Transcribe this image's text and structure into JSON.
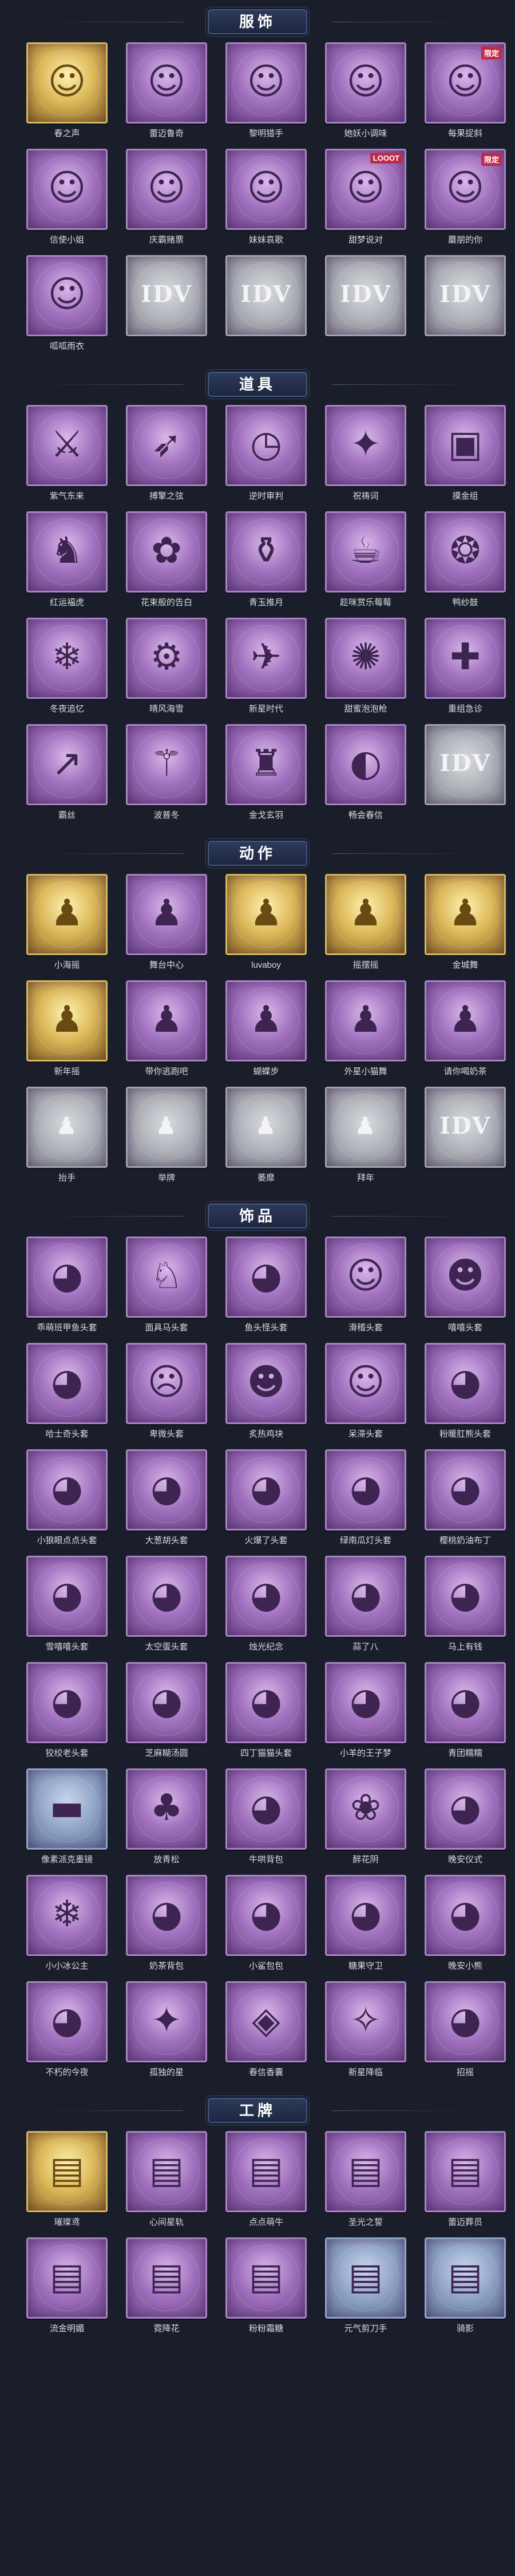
{
  "sections": [
    {
      "title": "服饰",
      "items": [
        {
          "label": "春之声",
          "style": "gold",
          "icon": "character-portrait-icon",
          "glyph": "☺"
        },
        {
          "label": "蕾迈鲁奇",
          "style": "purple",
          "icon": "character-portrait-icon",
          "glyph": "☺"
        },
        {
          "label": "黎明猎手",
          "style": "purple",
          "icon": "character-portrait-icon",
          "glyph": "☺"
        },
        {
          "label": "她妖小调味",
          "style": "purple",
          "icon": "character-portrait-icon",
          "glyph": "☺"
        },
        {
          "label": "每果捉斜",
          "style": "purple",
          "icon": "character-portrait-icon",
          "glyph": "☺",
          "badge": "限定"
        },
        {
          "label": "信使小姐",
          "style": "purple",
          "icon": "character-portrait-icon",
          "glyph": "☺"
        },
        {
          "label": "庆霸赌票",
          "style": "purple",
          "icon": "character-portrait-icon",
          "glyph": "☺"
        },
        {
          "label": "妹妹哀歌",
          "style": "purple",
          "icon": "character-portrait-icon",
          "glyph": "☺"
        },
        {
          "label": "甜梦说对",
          "style": "purple",
          "icon": "character-portrait-icon",
          "glyph": "☺",
          "badge": "LOOOT"
        },
        {
          "label": "蘑朋的你",
          "style": "purple",
          "icon": "character-portrait-icon",
          "glyph": "☺",
          "badge": "限定"
        },
        {
          "label": "呱呱雨衣",
          "style": "purple",
          "icon": "character-portrait-icon",
          "glyph": "☺"
        },
        {
          "label": "",
          "style": "locked",
          "icon": "locked-placeholder-icon",
          "glyph": "IDV"
        },
        {
          "label": "",
          "style": "locked",
          "icon": "locked-placeholder-icon",
          "glyph": "IDV"
        },
        {
          "label": "",
          "style": "locked",
          "icon": "locked-placeholder-icon",
          "glyph": "IDV"
        },
        {
          "label": "",
          "style": "locked",
          "icon": "locked-placeholder-icon",
          "glyph": "IDV"
        }
      ]
    },
    {
      "title": "道具",
      "items": [
        {
          "label": "紫气东来",
          "style": "purple",
          "icon": "weapon-icon",
          "glyph": "⚔"
        },
        {
          "label": "搏擎之弦",
          "style": "purple",
          "icon": "bow-icon",
          "glyph": "➶"
        },
        {
          "label": "逆时审判",
          "style": "purple",
          "icon": "clock-icon",
          "glyph": "◷"
        },
        {
          "label": "祝祷词",
          "style": "purple",
          "icon": "staff-icon",
          "glyph": "✦"
        },
        {
          "label": "摸金组",
          "style": "purple",
          "icon": "tile-icon",
          "glyph": "▣"
        },
        {
          "label": "红运福虎",
          "style": "purple",
          "icon": "tiger-icon",
          "glyph": "♞"
        },
        {
          "label": "花束般的告白",
          "style": "purple",
          "icon": "flower-icon",
          "glyph": "✿"
        },
        {
          "label": "青玉推月",
          "style": "purple",
          "icon": "bottle-icon",
          "glyph": "⚱"
        },
        {
          "label": "趁咪赏乐莓莓",
          "style": "purple",
          "icon": "milk-bottle-icon",
          "glyph": "☕"
        },
        {
          "label": "鸭纱鼓",
          "style": "purple",
          "icon": "drum-icon",
          "glyph": "❂"
        },
        {
          "label": "冬夜追忆",
          "style": "purple",
          "icon": "snow-globe-icon",
          "glyph": "❄"
        },
        {
          "label": "晴风海雪",
          "style": "purple",
          "icon": "robot-icon",
          "glyph": "⚙"
        },
        {
          "label": "新星时代",
          "style": "purple",
          "icon": "gun-icon",
          "glyph": "✈"
        },
        {
          "label": "甜蜜泡泡枪",
          "style": "purple",
          "icon": "bubble-gun-icon",
          "glyph": "✺"
        },
        {
          "label": "重组急诊",
          "style": "purple",
          "icon": "medkit-icon",
          "glyph": "✚"
        },
        {
          "label": "霸丝",
          "style": "purple",
          "icon": "spear-icon",
          "glyph": "↗"
        },
        {
          "label": "波普冬",
          "style": "purple",
          "icon": "wand-icon",
          "glyph": "⚚"
        },
        {
          "label": "金戈玄羽",
          "style": "purple",
          "icon": "lantern-icon",
          "glyph": "♜"
        },
        {
          "label": "畅会春信",
          "style": "purple",
          "icon": "fan-icon",
          "glyph": "◐"
        },
        {
          "label": "",
          "style": "locked",
          "icon": "locked-placeholder-icon",
          "glyph": "IDV"
        }
      ]
    },
    {
      "title": "动作",
      "items": [
        {
          "label": "小海摇",
          "style": "gold",
          "icon": "pose-icon",
          "glyph": "♟"
        },
        {
          "label": "舞台中心",
          "style": "purple",
          "icon": "pose-icon",
          "glyph": "♟"
        },
        {
          "label": "luvaboy",
          "style": "gold",
          "icon": "pose-icon",
          "glyph": "♟"
        },
        {
          "label": "摇摆摇",
          "style": "gold",
          "icon": "pose-icon",
          "glyph": "♟"
        },
        {
          "label": "金城舞",
          "style": "gold",
          "icon": "pose-icon",
          "glyph": "♟"
        },
        {
          "label": "新年摇",
          "style": "gold",
          "icon": "pose-icon",
          "glyph": "♟"
        },
        {
          "label": "带你逃跑吧",
          "style": "purple",
          "icon": "pose-icon",
          "glyph": "♟"
        },
        {
          "label": "蝴蝶步",
          "style": "purple",
          "icon": "pose-icon",
          "glyph": "♟"
        },
        {
          "label": "外星小猫舞",
          "style": "purple",
          "icon": "pose-icon",
          "glyph": "♟"
        },
        {
          "label": "请你喝奶茶",
          "style": "purple",
          "icon": "pose-icon",
          "glyph": "♟"
        },
        {
          "label": "抬手",
          "style": "locked",
          "icon": "pose-icon",
          "glyph": "♟"
        },
        {
          "label": "举牌",
          "style": "locked",
          "icon": "pose-icon",
          "glyph": "♟"
        },
        {
          "label": "萎靡",
          "style": "locked",
          "icon": "pose-icon",
          "glyph": "♟"
        },
        {
          "label": "拜年",
          "style": "locked",
          "icon": "pose-icon",
          "glyph": "♟"
        },
        {
          "label": "",
          "style": "locked",
          "icon": "locked-placeholder-icon",
          "glyph": "IDV"
        }
      ]
    },
    {
      "title": "饰品",
      "items": [
        {
          "label": "乖萌班甲鱼头套",
          "style": "purple",
          "icon": "head-accessory-icon",
          "glyph": "◕"
        },
        {
          "label": "面具马头套",
          "style": "purple",
          "icon": "horse-head-icon",
          "glyph": "♘"
        },
        {
          "label": "鱼头怪头套",
          "style": "purple",
          "icon": "fish-head-icon",
          "glyph": "◕"
        },
        {
          "label": "滑稽头套",
          "style": "purple",
          "icon": "smiley-head-icon",
          "glyph": "☺"
        },
        {
          "label": "嘻嘻头套",
          "style": "purple",
          "icon": "grin-head-icon",
          "glyph": "☻"
        },
        {
          "label": "哈士奇头套",
          "style": "purple",
          "icon": "dog-head-icon",
          "glyph": "◕"
        },
        {
          "label": "卑微头套",
          "style": "purple",
          "icon": "sad-head-icon",
          "glyph": "☹"
        },
        {
          "label": "炙热鸡块",
          "style": "purple",
          "icon": "nugget-head-icon",
          "glyph": "☻"
        },
        {
          "label": "呆滞头套",
          "style": "purple",
          "icon": "dazed-head-icon",
          "glyph": "☺"
        },
        {
          "label": "粉暖肛熊头套",
          "style": "purple",
          "icon": "bear-head-icon",
          "glyph": "◕"
        },
        {
          "label": "小狼眼点点头套",
          "style": "purple",
          "icon": "head-accessory-icon",
          "glyph": "◕"
        },
        {
          "label": "大葱胡头套",
          "style": "purple",
          "icon": "leek-head-icon",
          "glyph": "◕"
        },
        {
          "label": "火爆了头套",
          "style": "purple",
          "icon": "fire-head-icon",
          "glyph": "◕"
        },
        {
          "label": "绿南瓜灯头套",
          "style": "purple",
          "icon": "pumpkin-head-icon",
          "glyph": "◕"
        },
        {
          "label": "樱桃奶油布丁",
          "style": "purple",
          "icon": "pudding-head-icon",
          "glyph": "◕"
        },
        {
          "label": "雪嘻嘻头套",
          "style": "purple",
          "icon": "pig-head-icon",
          "glyph": "◕"
        },
        {
          "label": "太空蛋头套",
          "style": "purple",
          "icon": "egg-head-icon",
          "glyph": "◕"
        },
        {
          "label": "烛光纪念",
          "style": "purple",
          "icon": "candle-head-icon",
          "glyph": "◕"
        },
        {
          "label": "蒜了八",
          "style": "purple",
          "icon": "garlic-head-icon",
          "glyph": "◕"
        },
        {
          "label": "马上有钱",
          "style": "purple",
          "icon": "horse-toy-icon",
          "glyph": "◕"
        },
        {
          "label": "狡绞老头套",
          "style": "purple",
          "icon": "cloud-head-icon",
          "glyph": "◕"
        },
        {
          "label": "芝麻糊汤圆",
          "style": "purple",
          "icon": "dumpling-head-icon",
          "glyph": "◕"
        },
        {
          "label": "四丁猫猫头套",
          "style": "purple",
          "icon": "cat-head-icon",
          "glyph": "◕"
        },
        {
          "label": "小羊的王子梦",
          "style": "purple",
          "icon": "sheep-head-icon",
          "glyph": "◕"
        },
        {
          "label": "青团糯糯",
          "style": "purple",
          "icon": "qingtuan-head-icon",
          "glyph": "◕"
        },
        {
          "label": "像素派克墨镜",
          "style": "blue",
          "icon": "sunglasses-icon",
          "glyph": "▬"
        },
        {
          "label": "放青松",
          "style": "purple",
          "icon": "bonsai-icon",
          "glyph": "♣"
        },
        {
          "label": "牛哄背包",
          "style": "purple",
          "icon": "backpack-icon",
          "glyph": "◕"
        },
        {
          "label": "醉花阴",
          "style": "purple",
          "icon": "ornament-icon",
          "glyph": "❀"
        },
        {
          "label": "晚安仪式",
          "style": "purple",
          "icon": "pig-toy-icon",
          "glyph": "◕"
        },
        {
          "label": "小小冰公主",
          "style": "purple",
          "icon": "ice-princess-icon",
          "glyph": "❄"
        },
        {
          "label": "奶茶背包",
          "style": "purple",
          "icon": "milktea-bag-icon",
          "glyph": "◕"
        },
        {
          "label": "小鲨包包",
          "style": "purple",
          "icon": "shark-bag-icon",
          "glyph": "◕"
        },
        {
          "label": "糖果守卫",
          "style": "purple",
          "icon": "candy-guard-icon",
          "glyph": "◕"
        },
        {
          "label": "晚安小熊",
          "style": "purple",
          "icon": "bear-toy-icon",
          "glyph": "◕"
        },
        {
          "label": "不朽的今夜",
          "style": "purple",
          "icon": "pendant-icon",
          "glyph": "◕"
        },
        {
          "label": "孤独的星",
          "style": "purple",
          "icon": "star-pendant-icon",
          "glyph": "✦"
        },
        {
          "label": "春信香囊",
          "style": "purple",
          "icon": "sachet-icon",
          "glyph": "◈"
        },
        {
          "label": "新星降临",
          "style": "purple",
          "icon": "charm-icon",
          "glyph": "✧"
        },
        {
          "label": "招摇",
          "style": "purple",
          "icon": "mascot-icon",
          "glyph": "◕"
        }
      ]
    },
    {
      "title": "工牌",
      "items": [
        {
          "label": "璀璨鸢",
          "style": "gold",
          "icon": "badge-card-icon",
          "glyph": "▤"
        },
        {
          "label": "心间星轨",
          "style": "purple",
          "icon": "badge-card-icon",
          "glyph": "▤"
        },
        {
          "label": "点点萌牛",
          "style": "purple",
          "icon": "badge-card-icon",
          "glyph": "▤"
        },
        {
          "label": "圣光之誓",
          "style": "purple",
          "icon": "badge-card-icon",
          "glyph": "▤"
        },
        {
          "label": "蕾迈葬员",
          "style": "purple",
          "icon": "badge-card-icon",
          "glyph": "▤"
        },
        {
          "label": "流金明媚",
          "style": "purple",
          "icon": "badge-card-icon",
          "glyph": "▤"
        },
        {
          "label": "霓降花",
          "style": "purple",
          "icon": "badge-card-icon",
          "glyph": "▤"
        },
        {
          "label": "粉粉霜糖",
          "style": "purple",
          "icon": "badge-card-icon",
          "glyph": "▤"
        },
        {
          "label": "元气剪刀手",
          "style": "blue",
          "icon": "badge-card-icon",
          "glyph": "▤"
        },
        {
          "label": "骑影",
          "style": "blue",
          "icon": "badge-card-icon",
          "glyph": "▤"
        }
      ]
    }
  ]
}
